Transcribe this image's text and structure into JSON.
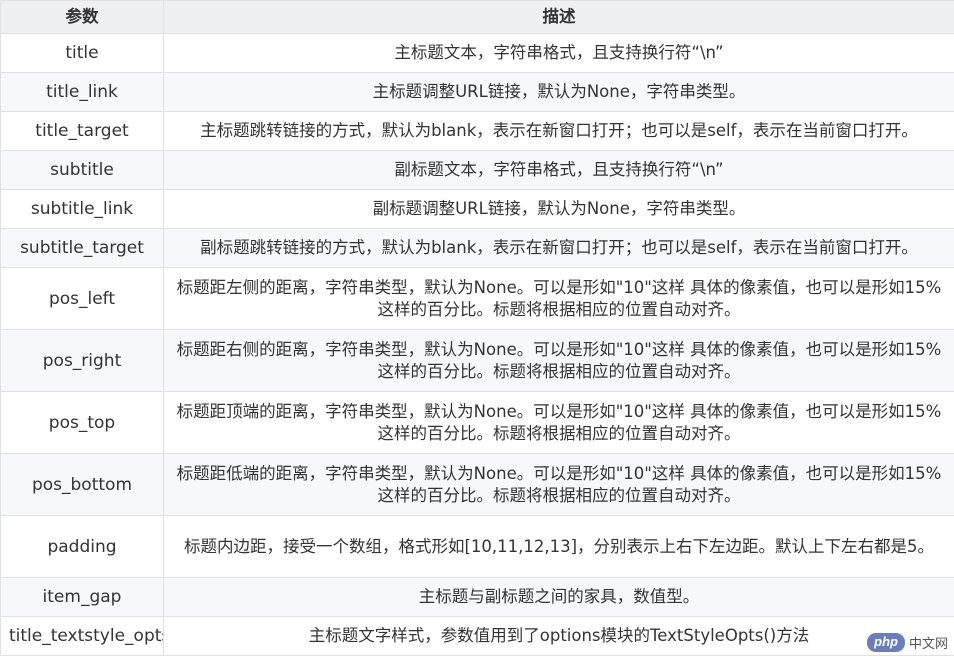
{
  "table": {
    "headers": [
      "参数",
      "描述"
    ],
    "rows": [
      {
        "param": "title",
        "desc": "主标题文本，字符串格式，且支持换行符“\\n”"
      },
      {
        "param": "title_link",
        "desc": "主标题调整URL链接，默认为None，字符串类型。"
      },
      {
        "param": "title_target",
        "desc": "主标题跳转链接的方式，默认为blank，表示在新窗口打开；也可以是self，表示在当前窗口打开。"
      },
      {
        "param": "subtitle",
        "desc": "副标题文本，字符串格式，且支持换行符“\\n”"
      },
      {
        "param": "subtitle_link",
        "desc": "副标题调整URL链接，默认为None，字符串类型。"
      },
      {
        "param": "subtitle_target",
        "desc": "副标题跳转链接的方式，默认为blank，表示在新窗口打开；也可以是self，表示在当前窗口打开。"
      },
      {
        "param": "pos_left",
        "desc": "标题距左侧的距离，字符串类型，默认为None。可以是形如\"10\"这样 具体的像素值，也可以是形如15%这样的百分比。标题将根据相应的位置自动对齐。"
      },
      {
        "param": "pos_right",
        "desc": "标题距右侧的距离，字符串类型，默认为None。可以是形如\"10\"这样 具体的像素值，也可以是形如15%这样的百分比。标题将根据相应的位置自动对齐。"
      },
      {
        "param": "pos_top",
        "desc": "标题距顶端的距离，字符串类型，默认为None。可以是形如\"10\"这样 具体的像素值，也可以是形如15%这样的百分比。标题将根据相应的位置自动对齐。"
      },
      {
        "param": "pos_bottom",
        "desc": "标题距低端的距离，字符串类型，默认为None。可以是形如\"10\"这样 具体的像素值，也可以是形如15%这样的百分比。标题将根据相应的位置自动对齐。"
      },
      {
        "param": "padding",
        "desc": "标题内边距，接受一个数组，格式形如[10,11,12,13]，分别表示上右下左边距。默认上下左右都是5。"
      },
      {
        "param": "item_gap",
        "desc": "主标题与副标题之间的家具，数值型。"
      },
      {
        "param": "title_textstyle_opts",
        "desc": "主标题文字样式，参数值用到了options模块的TextStyleOpts()方法"
      }
    ]
  },
  "watermark": {
    "logo": "php",
    "site": "中文网"
  }
}
